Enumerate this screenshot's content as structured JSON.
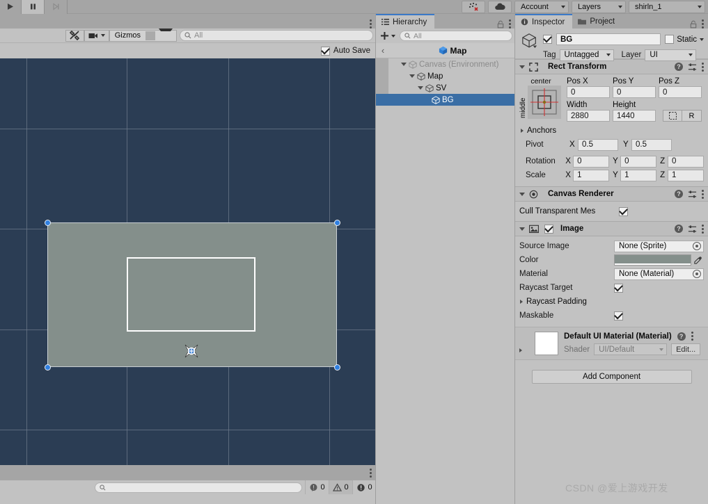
{
  "toolbar": {
    "play_icon": "play-icon",
    "pause_icon": "pause-icon",
    "step_icon": "step-icon",
    "collab_icon": "collab-icon",
    "cloud_icon": "cloud-icon",
    "account_label": "Account",
    "layers_label": "Layers",
    "layout_label": "shirln_1"
  },
  "scene": {
    "tools_icon": "tools-icon",
    "camera_icon": "camera-icon",
    "gizmos_label": "Gizmos",
    "search_placeholder": "All",
    "search_value": "",
    "autosave_label": "Auto Save",
    "autosave_checked": true,
    "background_color": "#2b3d54",
    "rect_color": "#848f8b",
    "handle_color": "#2f7fe0",
    "grid_color": "#6d7a8b"
  },
  "console": {
    "search_placeholder": "",
    "log_count": "0",
    "warn_count": "0",
    "error_count": "0"
  },
  "hierarchy": {
    "tab_label": "Hierarchy",
    "add_label": "+",
    "search_placeholder": "All",
    "search_value": "",
    "breadcrumb_title": "Map",
    "tree": [
      {
        "label": "Canvas (Environment)",
        "depth": 0,
        "expanded": true,
        "selected": false,
        "dim": true
      },
      {
        "label": "Map",
        "depth": 1,
        "expanded": true,
        "selected": false,
        "dim": false
      },
      {
        "label": "SV",
        "depth": 2,
        "expanded": true,
        "selected": false,
        "dim": false
      },
      {
        "label": "BG",
        "depth": 3,
        "expanded": false,
        "selected": true,
        "dim": false
      }
    ]
  },
  "inspector": {
    "tab_label": "Inspector",
    "project_tab_label": "Project",
    "object_name": "BG",
    "object_enabled": true,
    "static_label": "Static",
    "static_checked": false,
    "tag_label": "Tag",
    "tag_value": "Untagged",
    "layer_label": "Layer",
    "layer_value": "UI",
    "rect_transform": {
      "title": "Rect Transform",
      "anchor_preset_h": "center",
      "anchor_preset_v": "middle",
      "pos_x_label": "Pos X",
      "pos_x": "0",
      "pos_y_label": "Pos Y",
      "pos_y": "0",
      "pos_z_label": "Pos Z",
      "pos_z": "0",
      "width_label": "Width",
      "width": "2880",
      "height_label": "Height",
      "height": "1440",
      "blueprint_label": "",
      "raw_label": "R",
      "anchors_label": "Anchors",
      "pivot_label": "Pivot",
      "pivot_x": "0.5",
      "pivot_y": "0.5",
      "rotation_label": "Rotation",
      "rot_x": "0",
      "rot_y": "0",
      "rot_z": "0",
      "scale_label": "Scale",
      "scale_x": "1",
      "scale_y": "1",
      "scale_z": "1"
    },
    "canvas_renderer": {
      "title": "Canvas Renderer",
      "cull_label": "Cull Transparent Mes",
      "cull_checked": true
    },
    "image": {
      "title": "Image",
      "enabled": true,
      "source_image_label": "Source Image",
      "source_image_value": "None (Sprite)",
      "color_label": "Color",
      "color_value": "#848f8b",
      "material_label": "Material",
      "material_value": "None (Material)",
      "raycast_target_label": "Raycast Target",
      "raycast_target_checked": true,
      "raycast_padding_label": "Raycast Padding",
      "maskable_label": "Maskable",
      "maskable_checked": true
    },
    "material_block": {
      "title": "Default UI Material (Material)",
      "shader_label": "Shader",
      "shader_value": "UI/Default",
      "edit_label": "Edit..."
    },
    "add_component_label": "Add Component"
  },
  "watermark": "CSDN @爱上游戏开发"
}
